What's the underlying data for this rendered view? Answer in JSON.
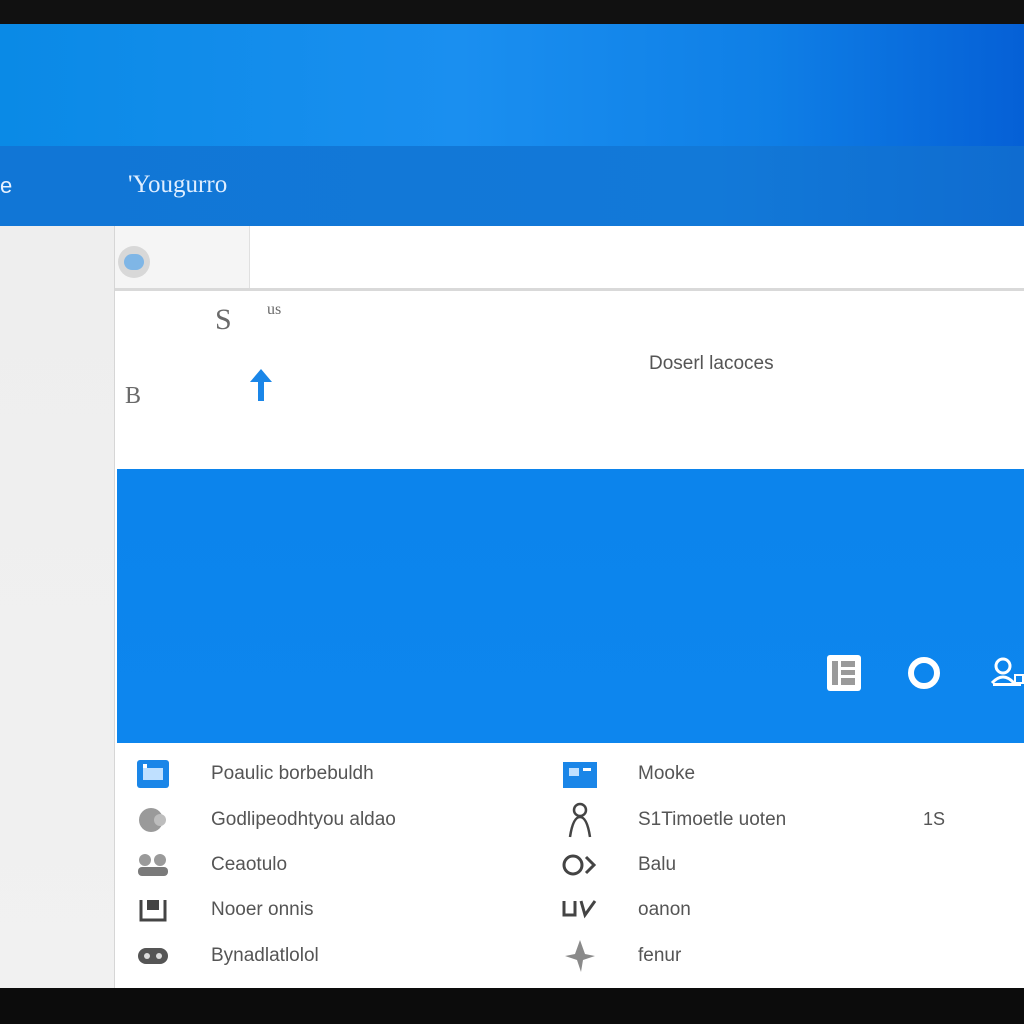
{
  "window": {
    "title": "'Yougurro",
    "edge_glyph": "e"
  },
  "search": {
    "value": "",
    "placeholder": ""
  },
  "upper_panel": {
    "glyph_top": "S",
    "glyph_small": "us",
    "glyph_left": "B",
    "download_label": "Doserl lacoces"
  },
  "banner": {
    "icons": [
      "document-icon",
      "refresh-icon",
      "user-settings-icon"
    ]
  },
  "list": {
    "left": [
      {
        "icon": "calendar-icon",
        "label": "Poaulic borbebuldh"
      },
      {
        "icon": "circle-icon",
        "label": "Godlipeodhtyou aldao"
      },
      {
        "icon": "group-icon",
        "label": "Ceaotulo"
      },
      {
        "icon": "box-icon",
        "label": "Nooer onnis"
      },
      {
        "icon": "gamepad-icon",
        "label": "Bynadlatlolol"
      }
    ],
    "right": [
      {
        "icon": "folder-icon",
        "label": "Mooke"
      },
      {
        "icon": "person-icon",
        "label": "S1Timoetle uoten"
      },
      {
        "icon": "badge-icon",
        "label": "Balu"
      },
      {
        "icon": "cup-icon",
        "label": "oanon"
      },
      {
        "icon": "pin-icon",
        "label": "fenur"
      }
    ],
    "count": "1S"
  },
  "colors": {
    "accent": "#0d86ee",
    "title_bar": "#1279d8",
    "top_band": "#1a8ff0"
  }
}
